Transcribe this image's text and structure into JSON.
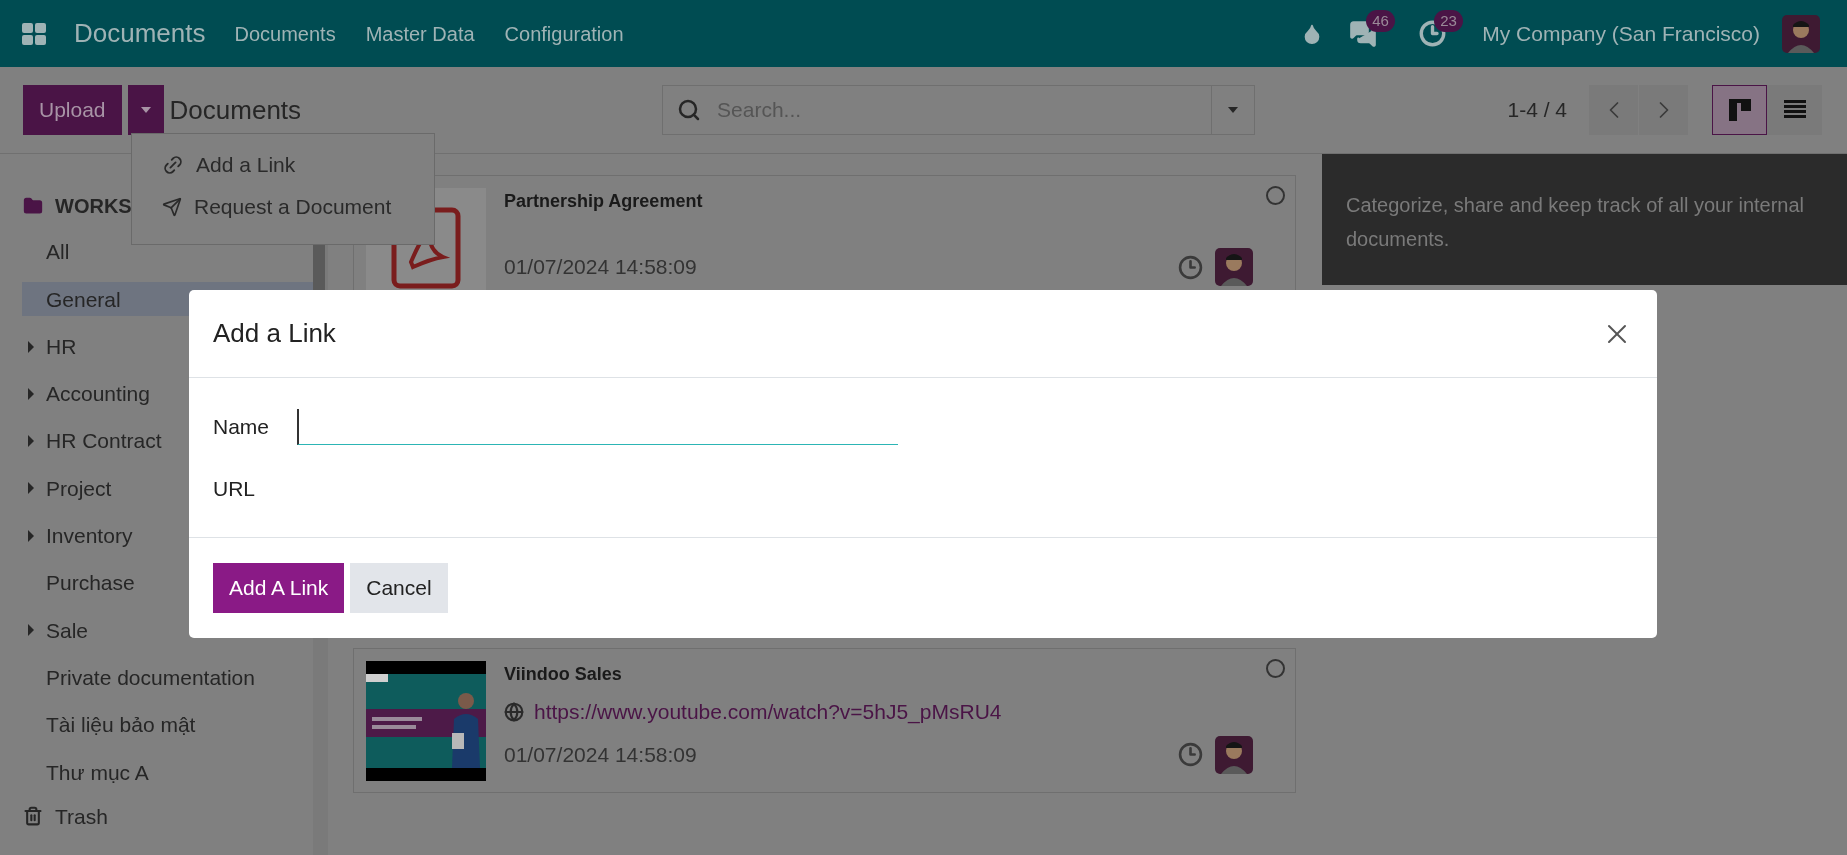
{
  "navbar": {
    "app_title": "Documents",
    "menu": [
      "Documents",
      "Master Data",
      "Configuration"
    ],
    "messages_badge": "46",
    "activities_badge": "23",
    "company": "My Company (San Francisco)"
  },
  "control_panel": {
    "upload_button": "Upload",
    "breadcrumb": "Documents",
    "search": {
      "placeholder": "Search..."
    },
    "pager": "1-4 / 4",
    "views": [
      {
        "kind": "kanban",
        "selected": true
      },
      {
        "kind": "list",
        "selected": false
      }
    ]
  },
  "upload_menu": [
    {
      "kind": "link",
      "label": "Add a Link"
    },
    {
      "kind": "request",
      "label": "Request a Document"
    }
  ],
  "sidebar": {
    "header": "WORKS",
    "items": [
      {
        "label": "All",
        "kind": "leaf",
        "selected": false
      },
      {
        "label": "General",
        "kind": "leaf",
        "selected": true
      },
      {
        "label": "HR",
        "kind": "group",
        "selected": false
      },
      {
        "label": "Accounting",
        "kind": "group",
        "selected": false
      },
      {
        "label": "HR Contract",
        "kind": "group",
        "selected": false
      },
      {
        "label": "Project",
        "kind": "group",
        "selected": false
      },
      {
        "label": "Inventory",
        "kind": "group",
        "selected": false
      },
      {
        "label": "Purchase",
        "kind": "leaf",
        "selected": false
      },
      {
        "label": "Sale",
        "kind": "group",
        "selected": false
      },
      {
        "label": "Private documentation",
        "kind": "leaf",
        "selected": false
      },
      {
        "label": "Tài liệu bảo mật",
        "kind": "leaf",
        "selected": false
      },
      {
        "label": "Thư mục A",
        "kind": "leaf",
        "selected": false
      }
    ],
    "trash": "Trash"
  },
  "cards": [
    {
      "kind": "pdf",
      "title": "Partnership Agreement",
      "date": "01/07/2024 14:58:09",
      "selected": false
    },
    {
      "kind": "video",
      "title": "Viindoo Sales",
      "url": "https://www.youtube.com/watch?v=5hJ5_pMsRU4",
      "date": "01/07/2024 14:58:09",
      "selected": false
    }
  ],
  "help_panel": {
    "text": "Categorize, share and keep track of all your internal documents."
  },
  "dialog": {
    "title": "Add a Link",
    "fields": [
      {
        "label": "Name",
        "kind": "input"
      },
      {
        "label": "URL",
        "kind": "plain"
      }
    ],
    "buttons": [
      {
        "label": "Add A Link",
        "kind": "primary"
      },
      {
        "label": "Cancel",
        "kind": "secondary"
      }
    ]
  }
}
